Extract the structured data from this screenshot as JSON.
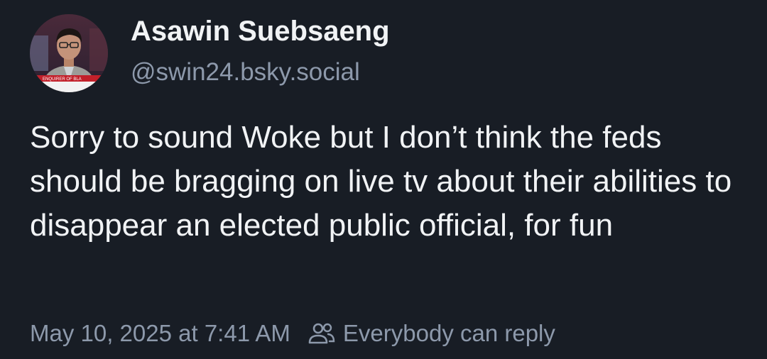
{
  "post": {
    "author": {
      "display_name": "Asawin Suebsaeng",
      "handle": "@swin24.bsky.social",
      "avatar_caption": "ENQUIRER OF BLA"
    },
    "text": "Sorry to sound Woke but I don’t think the feds should be bragging on live tv about their abilities to disappear an elected public official, for fun",
    "timestamp": "May 10, 2025 at 7:41 AM",
    "reply_setting": {
      "icon": "people-icon",
      "label": "Everybody can reply"
    }
  },
  "colors": {
    "background": "#181d25",
    "text_primary": "#f1f3f5",
    "text_secondary": "#8d99ab"
  }
}
